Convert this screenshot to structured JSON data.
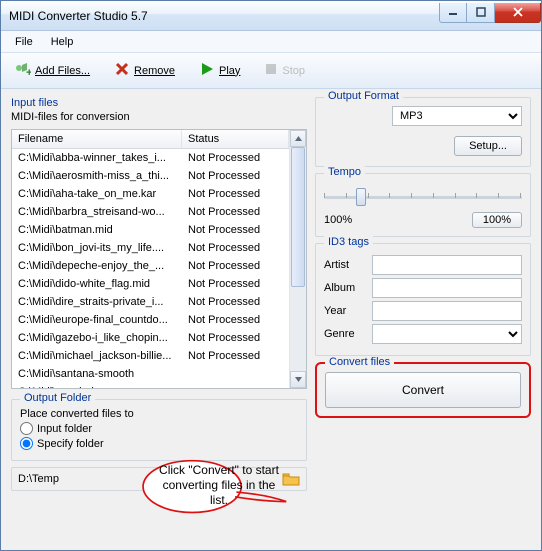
{
  "window": {
    "title": "MIDI Converter Studio 5.7"
  },
  "menu": {
    "file": "File",
    "help": "Help"
  },
  "toolbar": {
    "addfiles": "Add Files...",
    "remove": "Remove",
    "play": "Play",
    "stop": "Stop"
  },
  "inputfiles": {
    "title": "Input files",
    "subtitle": "MIDI-files for conversion",
    "col_filename": "Filename",
    "col_status": "Status",
    "rows": [
      {
        "fn": "C:\\Midi\\abba-winner_takes_i...",
        "st": "Not Processed"
      },
      {
        "fn": "C:\\Midi\\aerosmith-miss_a_thi...",
        "st": "Not Processed"
      },
      {
        "fn": "C:\\Midi\\aha-take_on_me.kar",
        "st": "Not Processed"
      },
      {
        "fn": "C:\\Midi\\barbra_streisand-wo...",
        "st": "Not Processed"
      },
      {
        "fn": "C:\\Midi\\batman.mid",
        "st": "Not Processed"
      },
      {
        "fn": "C:\\Midi\\bon_jovi-its_my_life....",
        "st": "Not Processed"
      },
      {
        "fn": "C:\\Midi\\depeche-enjoy_the_...",
        "st": "Not Processed"
      },
      {
        "fn": "C:\\Midi\\dido-white_flag.mid",
        "st": "Not Processed"
      },
      {
        "fn": "C:\\Midi\\dire_straits-private_i...",
        "st": "Not Processed"
      },
      {
        "fn": "C:\\Midi\\europe-final_countdo...",
        "st": "Not Processed"
      },
      {
        "fn": "C:\\Midi\\gazebo-i_like_chopin...",
        "st": "Not Processed"
      },
      {
        "fn": "C:\\Midi\\michael_jackson-billie...",
        "st": "Not Processed"
      },
      {
        "fn": "C:\\Midi\\santana-smooth",
        "st": ""
      },
      {
        "fn": "C:\\Midi\\sugababes-",
        "st": ""
      }
    ]
  },
  "outputfolder": {
    "title": "Output Folder",
    "place_label": "Place converted files to",
    "opt_input": "Input folder",
    "opt_specify": "Specify folder",
    "path": "D:\\Temp"
  },
  "outputformat": {
    "title": "Output Format",
    "value": "MP3",
    "setup": "Setup..."
  },
  "tempo": {
    "title": "Tempo",
    "left": "100%",
    "btn": "100%"
  },
  "id3": {
    "title": "ID3 tags",
    "artist_lbl": "Artist",
    "album_lbl": "Album",
    "year_lbl": "Year",
    "genre_lbl": "Genre",
    "artist": "",
    "album": "",
    "year": "",
    "genre": ""
  },
  "convert": {
    "title": "Convert files",
    "button": "Convert"
  },
  "callout": "Click \"Convert\" to start converting files in the list."
}
